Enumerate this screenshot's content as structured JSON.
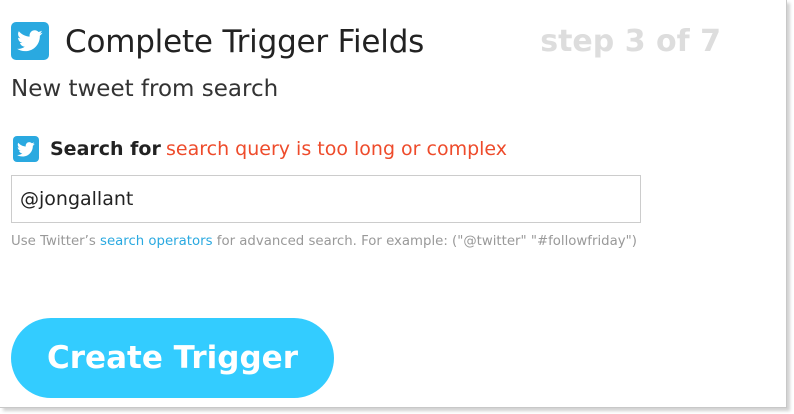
{
  "header": {
    "icon": "twitter-icon",
    "title": "Complete Trigger Fields",
    "step": "step 3 of 7"
  },
  "subtitle": "New tweet from search",
  "field": {
    "icon": "twitter-icon",
    "label": "Search for",
    "error": "search query is too long or complex",
    "value": "@jongallant"
  },
  "help": {
    "prefix": "Use Twitter’s ",
    "link": "search operators",
    "suffix": " for advanced search. For example: (\"@twitter\" \"#followfriday\")"
  },
  "button": {
    "label": "Create Trigger"
  },
  "colors": {
    "twitter_blue": "#2aa9e0",
    "button_blue": "#33ccff",
    "error_red": "#ee4b2b",
    "step_gray": "#dddddd"
  }
}
